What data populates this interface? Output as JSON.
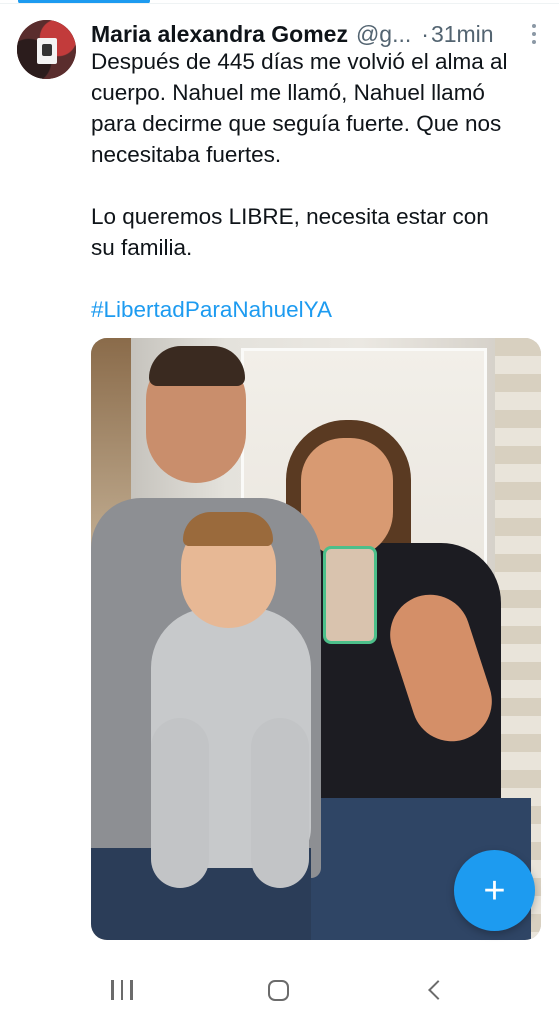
{
  "tweet": {
    "author_name": "Maria alexandra Gomez",
    "author_handle": "@g...",
    "separator": "·",
    "time": "31min",
    "text_lines": [
      "Después de 445 días me volvió el alma al",
      "cuerpo. Nahuel me llamó, Nahuel llamó",
      "para decirme que seguía fuerte. Que nos",
      "necesitaba fuertes.",
      "Lo queremos LIBRE, necesita estar con",
      "su familia."
    ],
    "hashtag": "#LibertadParaNahuelYA",
    "avatar_icon": "user-avatar-image",
    "more_icon": "more-options-icon",
    "photo": "family-selfie-photo"
  },
  "fab": {
    "label": "+",
    "icon": "compose-plus-icon"
  },
  "navigation": {
    "recents_icon": "recents-icon",
    "home_icon": "home-icon",
    "back_icon": "back-icon"
  },
  "colors": {
    "accent": "#1d9bf0",
    "text": "#0f1419",
    "secondary_text": "#536471",
    "background": "#ffffff"
  }
}
